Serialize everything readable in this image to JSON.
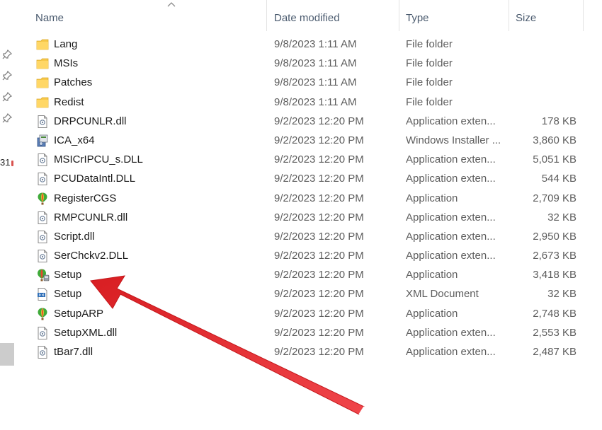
{
  "columns": {
    "name": "Name",
    "date_modified": "Date modified",
    "type": "Type",
    "size": "Size"
  },
  "nav_fragment_text": "31",
  "files": [
    {
      "name": "Lang",
      "date": "9/8/2023 1:11 AM",
      "type": "File folder",
      "size": "",
      "icon": "folder-icon"
    },
    {
      "name": "MSIs",
      "date": "9/8/2023 1:11 AM",
      "type": "File folder",
      "size": "",
      "icon": "folder-icon"
    },
    {
      "name": "Patches",
      "date": "9/8/2023 1:11 AM",
      "type": "File folder",
      "size": "",
      "icon": "folder-icon"
    },
    {
      "name": "Redist",
      "date": "9/8/2023 1:11 AM",
      "type": "File folder",
      "size": "",
      "icon": "folder-icon"
    },
    {
      "name": "DRPCUNLR.dll",
      "date": "9/2/2023 12:20 PM",
      "type": "Application exten...",
      "size": "178 KB",
      "icon": "dll-file-icon"
    },
    {
      "name": "ICA_x64",
      "date": "9/2/2023 12:20 PM",
      "type": "Windows Installer ...",
      "size": "3,860 KB",
      "icon": "installer-package-icon"
    },
    {
      "name": "MSICrIPCU_s.DLL",
      "date": "9/2/2023 12:20 PM",
      "type": "Application exten...",
      "size": "5,051 KB",
      "icon": "dll-file-icon"
    },
    {
      "name": "PCUDataIntl.DLL",
      "date": "9/2/2023 12:20 PM",
      "type": "Application exten...",
      "size": "544 KB",
      "icon": "dll-file-icon"
    },
    {
      "name": "RegisterCGS",
      "date": "9/2/2023 12:20 PM",
      "type": "Application",
      "size": "2,709 KB",
      "icon": "balloon-app-icon"
    },
    {
      "name": "RMPCUNLR.dll",
      "date": "9/2/2023 12:20 PM",
      "type": "Application exten...",
      "size": "32 KB",
      "icon": "dll-file-icon"
    },
    {
      "name": "Script.dll",
      "date": "9/2/2023 12:20 PM",
      "type": "Application exten...",
      "size": "2,950 KB",
      "icon": "dll-file-icon"
    },
    {
      "name": "SerChckv2.DLL",
      "date": "9/2/2023 12:20 PM",
      "type": "Application exten...",
      "size": "2,673 KB",
      "icon": "dll-file-icon"
    },
    {
      "name": "Setup",
      "date": "9/2/2023 12:20 PM",
      "type": "Application",
      "size": "3,418 KB",
      "icon": "setup-app-icon"
    },
    {
      "name": "Setup",
      "date": "9/2/2023 12:20 PM",
      "type": "XML Document",
      "size": "32 KB",
      "icon": "xml-document-icon"
    },
    {
      "name": "SetupARP",
      "date": "9/2/2023 12:20 PM",
      "type": "Application",
      "size": "2,748 KB",
      "icon": "balloon-app-icon"
    },
    {
      "name": "SetupXML.dll",
      "date": "9/2/2023 12:20 PM",
      "type": "Application exten...",
      "size": "2,553 KB",
      "icon": "dll-file-icon"
    },
    {
      "name": "tBar7.dll",
      "date": "9/2/2023 12:20 PM",
      "type": "Application exten...",
      "size": "2,487 KB",
      "icon": "dll-file-icon"
    }
  ],
  "colors": {
    "folder": "#f7c84a",
    "header_text": "#4a5a6e",
    "secondary_text": "#5d5d5d",
    "annotation_arrow": "#e8262a"
  }
}
